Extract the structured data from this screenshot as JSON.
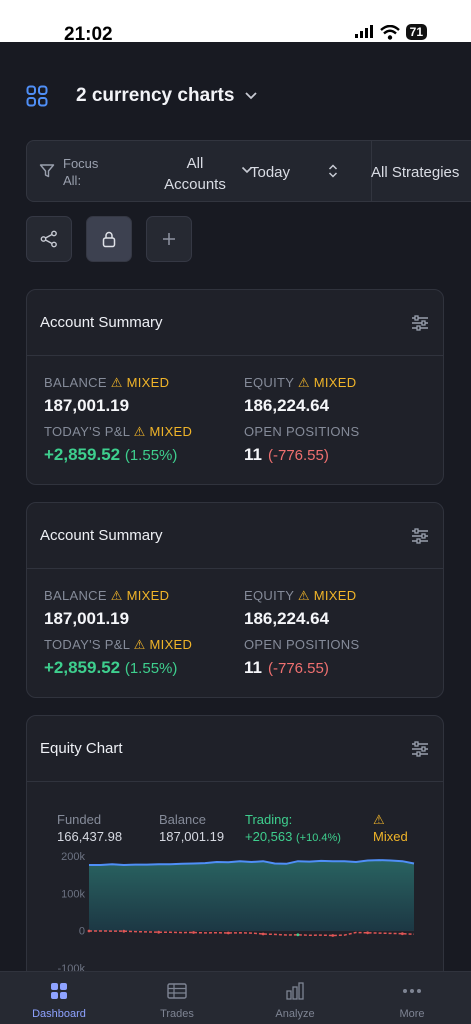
{
  "status": {
    "time": "21:02",
    "battery": "71"
  },
  "header": {
    "title": "2 currency charts"
  },
  "filters": {
    "focus_label": "Focus",
    "focus_value": "All:",
    "accounts_line1": "All",
    "accounts_line2": "Accounts",
    "period": "Today",
    "strategies": "All Strategies"
  },
  "cards": [
    {
      "title": "Account Summary",
      "balance_label": "BALANCE",
      "mixed": "⚠ MIXED",
      "balance": "187,001.19",
      "equity_label": "EQUITY",
      "equity": "186,224.64",
      "pnl_label": "TODAY'S P&L",
      "pnl": "+2,859.52",
      "pnl_pct": "(1.55%)",
      "open_label": "OPEN POSITIONS",
      "open_count": "11",
      "open_pnl": "(-776.55)"
    },
    {
      "title": "Account Summary",
      "balance_label": "BALANCE",
      "mixed": "⚠ MIXED",
      "balance": "187,001.19",
      "equity_label": "EQUITY",
      "equity": "186,224.64",
      "pnl_label": "TODAY'S P&L",
      "pnl": "+2,859.52",
      "pnl_pct": "(1.55%)",
      "open_label": "OPEN POSITIONS",
      "open_count": "11",
      "open_pnl": "(-776.55)"
    }
  ],
  "equity": {
    "title": "Equity Chart",
    "funded_label": "Funded",
    "funded_value": "166,437.98",
    "balance_label": "Balance",
    "balance_value": "187,001.19",
    "trading_label": "Trading:",
    "trading_value": "+20,563",
    "trading_pct": "(+10.4%)",
    "warn_icon": "⚠",
    "mixed_label": "Mixed"
  },
  "chart_data": {
    "type": "area",
    "yticks": [
      "200k",
      "100k",
      "0",
      "-100k"
    ],
    "ylim": [
      -100000,
      200000
    ],
    "series": [
      {
        "values": [
          176000,
          176000,
          178000,
          176000,
          177000,
          177000,
          178000,
          178000,
          179000,
          180000,
          181000,
          184000,
          183000,
          186000,
          184000,
          186000,
          180000,
          179000,
          186000,
          185000,
          187000,
          186000,
          186000,
          184000,
          188000,
          189000,
          188000,
          186000,
          180000
        ]
      },
      {
        "values": [
          -800,
          -900,
          -1200,
          -1500,
          -2400,
          -3200,
          -4000,
          -4500,
          -5200,
          -5000,
          -6000,
          -5500,
          -6200,
          -5800,
          -6500,
          -9000,
          -10000,
          -11500,
          -11000,
          -12500,
          -11800,
          -13000,
          -12000,
          -5000,
          -5800,
          -6400,
          -7200,
          -8000,
          -9500
        ]
      }
    ],
    "colors": {
      "line": "#4f8ff7",
      "area_top": "#2a6a67",
      "area_bottom": "#1c3a47",
      "pnl": "#e05555",
      "pnl_alt": "#3ecf8e"
    }
  },
  "nav": {
    "dashboard": "Dashboard",
    "trades": "Trades",
    "analyze": "Analyze",
    "more": "More"
  }
}
